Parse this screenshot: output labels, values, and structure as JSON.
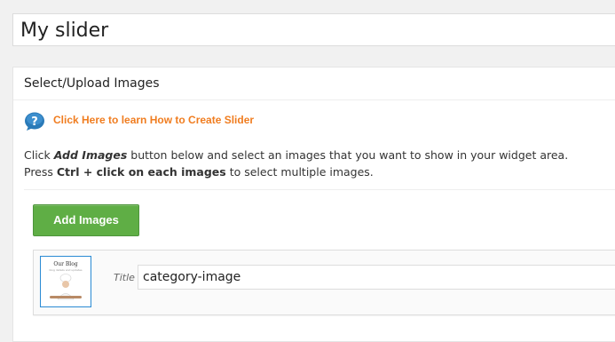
{
  "slider": {
    "title_value": "My slider"
  },
  "metabox": {
    "heading": "Select/Upload Images",
    "help_link": "Click Here to learn How to Create Slider",
    "help_icon": "question-bubble-icon",
    "instructions": {
      "line1_prefix": "Click ",
      "line1_emphasis": "Add Images",
      "line1_suffix": " button below and select an images that you want to show in your widget area.",
      "line2_prefix": "Press ",
      "line2_bold": "Ctrl + click on each images",
      "line2_suffix": " to select multiple images."
    },
    "add_button_label": "Add Images",
    "images": [
      {
        "title_label": "Title",
        "title_value": "category-image",
        "thumb_brand": "Our Blog",
        "thumb_sub": "blog details and updates"
      }
    ]
  },
  "colors": {
    "link_orange": "#f07d20",
    "button_green": "#5fae45",
    "help_icon_blue": "#2a7ab8",
    "thumb_border_blue": "#2a8ad4"
  }
}
